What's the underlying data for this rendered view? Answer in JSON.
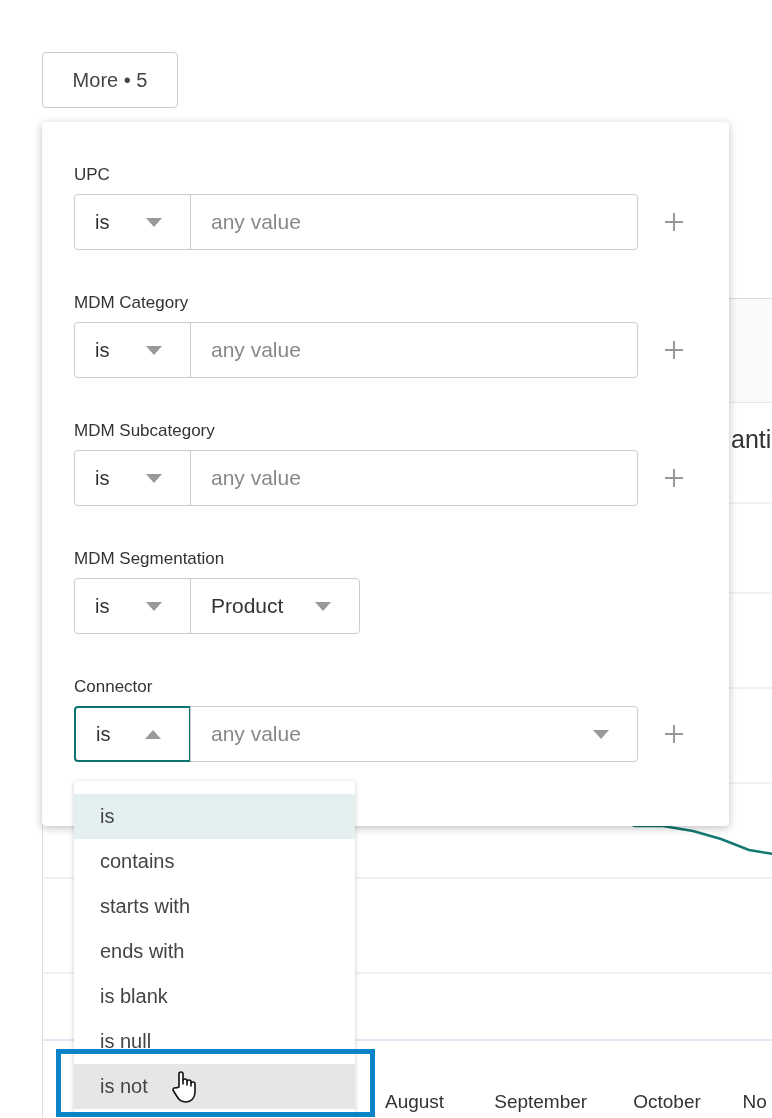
{
  "more_button": {
    "label": "More • 5"
  },
  "filters": [
    {
      "label": "UPC",
      "operator": "is",
      "expanded": false,
      "addable": true,
      "value": {
        "kind": "text",
        "placeholder": "any value"
      }
    },
    {
      "label": "MDM Category",
      "operator": "is",
      "expanded": false,
      "addable": true,
      "value": {
        "kind": "text",
        "placeholder": "any value"
      }
    },
    {
      "label": "MDM Subcategory",
      "operator": "is",
      "expanded": false,
      "addable": true,
      "value": {
        "kind": "text",
        "placeholder": "any value"
      }
    },
    {
      "label": "MDM Segmentation",
      "operator": "is",
      "expanded": false,
      "addable": false,
      "value": {
        "kind": "select",
        "text": "Product"
      }
    },
    {
      "label": "Connector",
      "operator": "is",
      "expanded": true,
      "addable": true,
      "value": {
        "kind": "combo",
        "placeholder": "any value"
      }
    }
  ],
  "operator_menu": [
    {
      "label": "is",
      "selected": true,
      "hovered": false
    },
    {
      "label": "contains",
      "selected": false,
      "hovered": false
    },
    {
      "label": "starts with",
      "selected": false,
      "hovered": false
    },
    {
      "label": "ends with",
      "selected": false,
      "hovered": false
    },
    {
      "label": "is blank",
      "selected": false,
      "hovered": false
    },
    {
      "label": "is null",
      "selected": false,
      "hovered": false
    },
    {
      "label": "is not",
      "selected": false,
      "hovered": true
    }
  ],
  "background_chart": {
    "title": "anti",
    "x_labels": [
      "August",
      "September",
      "October",
      "No"
    ]
  }
}
